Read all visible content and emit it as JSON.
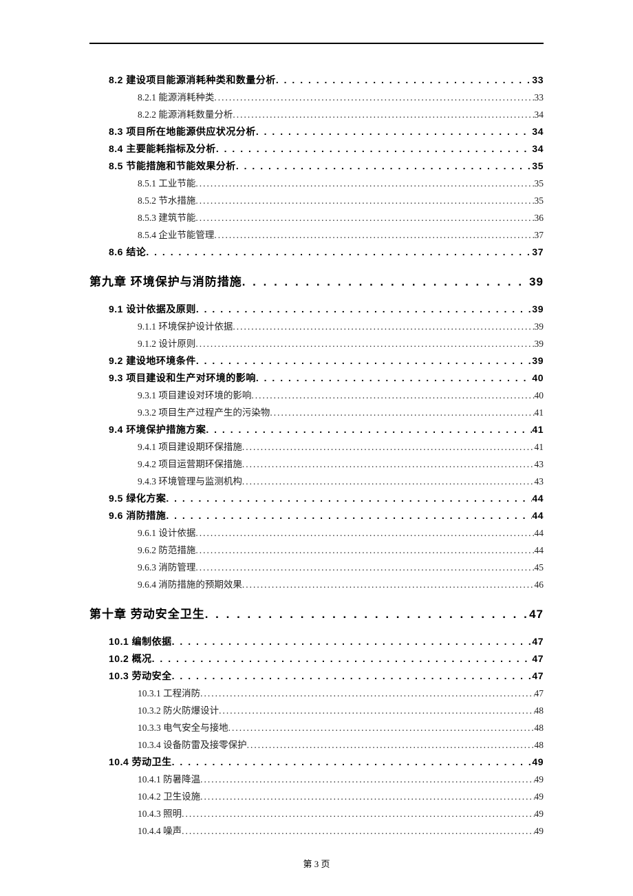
{
  "footer": "第 3 页",
  "toc": [
    {
      "level": 2,
      "text": "8.2 建设项目能源消耗种类和数量分析",
      "page": "33"
    },
    {
      "level": 3,
      "text": "8.2.1 能源消耗种类",
      "page": "33"
    },
    {
      "level": 3,
      "text": "8.2.2 能源消耗数量分析",
      "page": "34"
    },
    {
      "level": 2,
      "text": "8.3 项目所在地能源供应状况分析",
      "page": "34"
    },
    {
      "level": 2,
      "text": "8.4 主要能耗指标及分析",
      "page": "34"
    },
    {
      "level": 2,
      "text": "8.5 节能措施和节能效果分析",
      "page": "35"
    },
    {
      "level": 3,
      "text": "8.5.1 工业节能",
      "page": "35"
    },
    {
      "level": 3,
      "text": "8.5.2 节水措施",
      "page": "35"
    },
    {
      "level": 3,
      "text": "8.5.3 建筑节能",
      "page": "36"
    },
    {
      "level": 3,
      "text": "8.5.4 企业节能管理",
      "page": "37"
    },
    {
      "level": 2,
      "text": "8.6 结论",
      "page": "37"
    },
    {
      "level": 1,
      "text": "第九章  环境保护与消防措施",
      "page": "39"
    },
    {
      "level": 2,
      "text": "9.1 设计依据及原则",
      "page": "39"
    },
    {
      "level": 3,
      "text": "9.1.1 环境保护设计依据",
      "page": "39"
    },
    {
      "level": 3,
      "text": "9.1.2 设计原则",
      "page": "39"
    },
    {
      "level": 2,
      "text": "9.2 建设地环境条件",
      "page": "39"
    },
    {
      "level": 2,
      "text": "9.3  项目建设和生产对环境的影响",
      "page": "40"
    },
    {
      "level": 3,
      "text": "9.3.1  项目建设对环境的影响",
      "page": "40"
    },
    {
      "level": 3,
      "text": "9.3.2  项目生产过程产生的污染物",
      "page": "41"
    },
    {
      "level": 2,
      "text": "9.4  环境保护措施方案",
      "page": "41"
    },
    {
      "level": 3,
      "text": "9.4.1  项目建设期环保措施",
      "page": "41"
    },
    {
      "level": 3,
      "text": "9.4.2  项目运营期环保措施",
      "page": "43"
    },
    {
      "level": 3,
      "text": "9.4.3  环境管理与监测机构",
      "page": "43"
    },
    {
      "level": 2,
      "text": "9.5 绿化方案",
      "page": "44"
    },
    {
      "level": 2,
      "text": "9.6 消防措施",
      "page": "44"
    },
    {
      "level": 3,
      "text": "9.6.1 设计依据",
      "page": "44"
    },
    {
      "level": 3,
      "text": "9.6.2 防范措施",
      "page": "44"
    },
    {
      "level": 3,
      "text": "9.6.3 消防管理",
      "page": "45"
    },
    {
      "level": 3,
      "text": "9.6.4 消防措施的预期效果",
      "page": "46"
    },
    {
      "level": 1,
      "text": "第十章  劳动安全卫生",
      "page": "47"
    },
    {
      "level": 2,
      "text": "10.1  编制依据",
      "page": "47"
    },
    {
      "level": 2,
      "text": "10.2 概况",
      "page": "47"
    },
    {
      "level": 2,
      "text": "10.3  劳动安全",
      "page": "47"
    },
    {
      "level": 3,
      "text": "10.3.1 工程消防",
      "page": "47"
    },
    {
      "level": 3,
      "text": "10.3.2 防火防爆设计",
      "page": "48"
    },
    {
      "level": 3,
      "text": "10.3.3 电气安全与接地",
      "page": "48"
    },
    {
      "level": 3,
      "text": "10.3.4 设备防雷及接零保护",
      "page": "48"
    },
    {
      "level": 2,
      "text": "10.4 劳动卫生",
      "page": "49"
    },
    {
      "level": 3,
      "text": "10.4.1 防暑降温",
      "page": "49"
    },
    {
      "level": 3,
      "text": "10.4.2 卫生设施",
      "page": "49"
    },
    {
      "level": 3,
      "text": "10.4.3 照明",
      "page": "49"
    },
    {
      "level": 3,
      "text": "10.4.4 噪声",
      "page": "49"
    }
  ]
}
